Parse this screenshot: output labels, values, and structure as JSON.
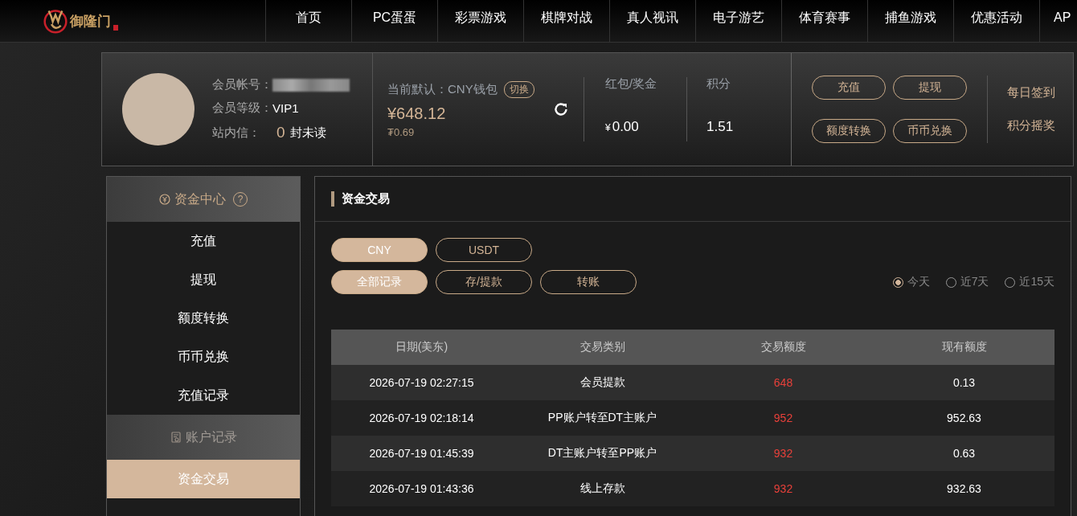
{
  "nav": {
    "logo_text": "御隆门",
    "items": [
      {
        "label": "首页"
      },
      {
        "label": "PC蛋蛋"
      },
      {
        "label": "彩票游戏"
      },
      {
        "label": "棋牌对战"
      },
      {
        "label": "真人视讯"
      },
      {
        "label": "电子游艺"
      },
      {
        "label": "体育赛事"
      },
      {
        "label": "捕鱼游戏"
      },
      {
        "label": "优惠活动"
      },
      {
        "label": "AP"
      }
    ]
  },
  "user": {
    "account_label": "会员帐号：",
    "level_label": "会员等级：",
    "level": "VIP1",
    "messages_label": "站内信：",
    "unread_count": "0",
    "unread_suffix": "封未读"
  },
  "wallet": {
    "label": "当前默认：CNY钱包",
    "switch_button": "切换",
    "balance": "¥648.12",
    "sub_balance": "₮0.69"
  },
  "bonus": {
    "label": "红包/奖金",
    "currency": "¥",
    "value": "0.00"
  },
  "points": {
    "label": "积分",
    "value": "1.51"
  },
  "actions": [
    "充值",
    "提现",
    "额度转换",
    "币币兑换"
  ],
  "links": [
    "每日签到",
    "积分摇奖"
  ],
  "sidebar": [
    {
      "title": "资金中心",
      "help_icon": "?",
      "items": [
        {
          "label": "充值",
          "selected": false
        },
        {
          "label": "提现",
          "selected": false
        },
        {
          "label": "额度转换",
          "selected": false
        },
        {
          "label": "币币兑换",
          "selected": false
        },
        {
          "label": "充值记录",
          "selected": false
        }
      ]
    },
    {
      "title": "账户记录",
      "items": [
        {
          "label": "资金交易",
          "selected": true
        }
      ]
    }
  ],
  "panel": {
    "title": "资金交易",
    "currency_tabs": [
      {
        "label": "CNY",
        "selected": true
      },
      {
        "label": "USDT",
        "selected": false
      }
    ],
    "type_tabs": [
      {
        "label": "全部记录",
        "selected": true
      },
      {
        "label": "存/提款",
        "selected": false
      },
      {
        "label": "转账",
        "selected": false
      }
    ],
    "date_range": [
      {
        "label": "今天",
        "selected": true
      },
      {
        "label": "近7天",
        "selected": false
      },
      {
        "label": "近15天",
        "selected": false
      }
    ],
    "table": {
      "columns": [
        "日期(美东)",
        "交易类别",
        "交易额度",
        "现有额度"
      ],
      "rows": [
        [
          "2026-07-19 02:27:15",
          "会员提款",
          "648",
          "0.13"
        ],
        [
          "2026-07-19 02:18:14",
          "PP账户转至DT主账户",
          "952",
          "952.63"
        ],
        [
          "2026-07-19 01:45:39",
          "DT主账户转至PP账户",
          "932",
          "0.63"
        ],
        [
          "2026-07-19 01:43:36",
          "线上存款",
          "932",
          "932.63"
        ]
      ]
    }
  }
}
